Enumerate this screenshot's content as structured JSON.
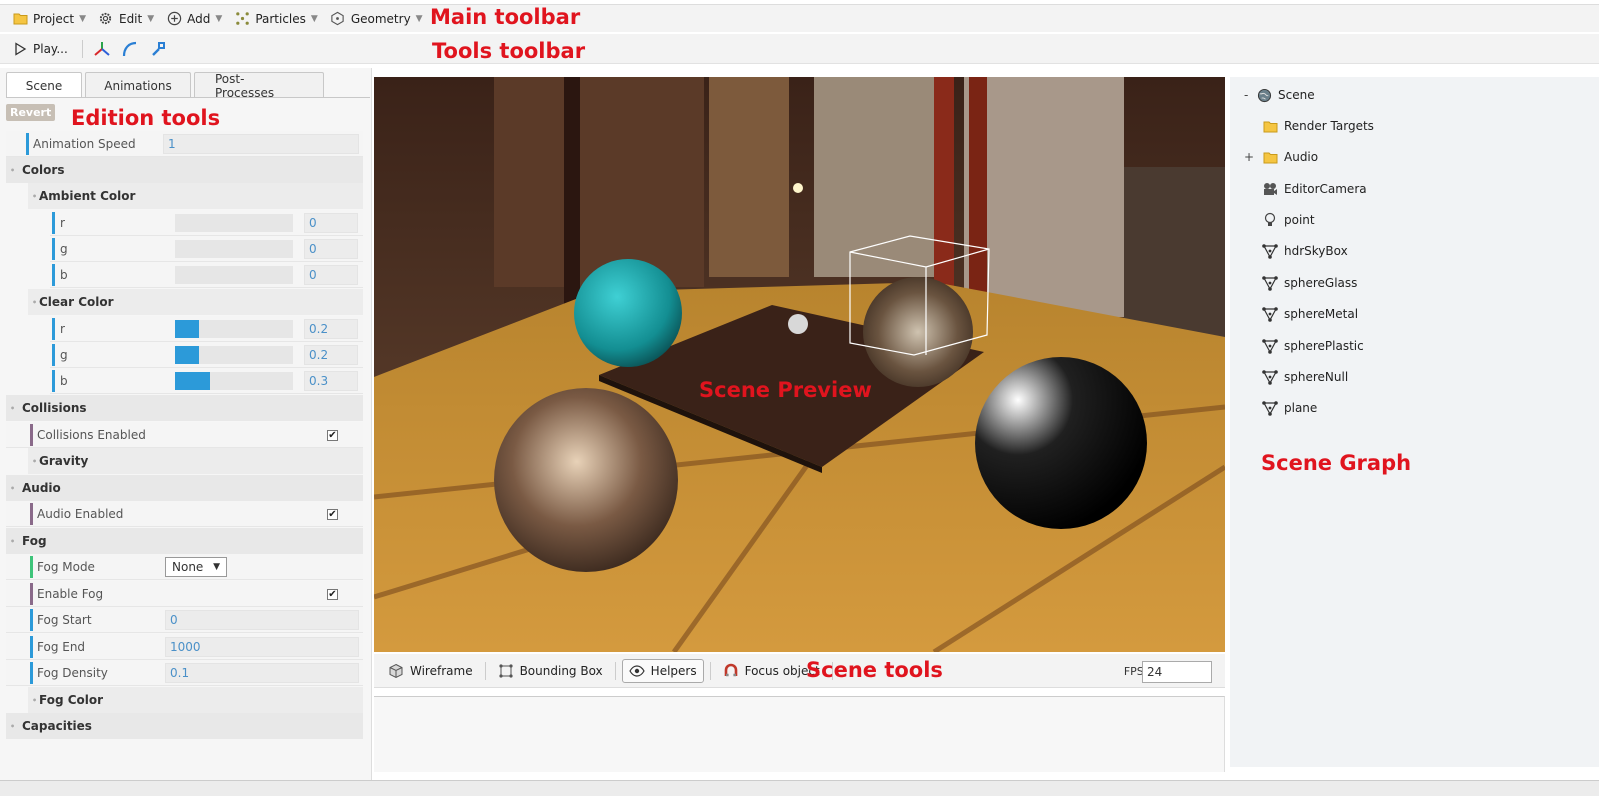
{
  "main_toolbar": {
    "project": "Project",
    "edit": "Edit",
    "add": "Add",
    "particles": "Particles",
    "geometry": "Geometry"
  },
  "tools_toolbar": {
    "play": "Play..."
  },
  "annotations": {
    "main_toolbar": "Main toolbar",
    "tools_toolbar": "Tools toolbar",
    "edition_tools": "Edition tools",
    "scene_preview": "Scene Preview",
    "scene_tools": "Scene tools",
    "scene_graph": "Scene Graph"
  },
  "tabs": [
    "Scene",
    "Animations",
    "Post-Processes"
  ],
  "edition": {
    "revert": "Revert",
    "animation_speed": {
      "label": "Animation Speed",
      "value": "1"
    },
    "colors": "Colors",
    "ambient_color": {
      "title": "Ambient Color",
      "r": {
        "label": "r",
        "value": "0",
        "fraction": 0
      },
      "g": {
        "label": "g",
        "value": "0",
        "fraction": 0
      },
      "b": {
        "label": "b",
        "value": "0",
        "fraction": 0
      }
    },
    "clear_color": {
      "title": "Clear Color",
      "r": {
        "label": "r",
        "value": "0.2",
        "fraction": 0.2
      },
      "g": {
        "label": "g",
        "value": "0.2",
        "fraction": 0.2
      },
      "b": {
        "label": "b",
        "value": "0.3",
        "fraction": 0.3
      }
    },
    "collisions": "Collisions",
    "collisions_enabled": {
      "label": "Collisions Enabled",
      "checked": true
    },
    "gravity": "Gravity",
    "audio": "Audio",
    "audio_enabled": {
      "label": "Audio Enabled",
      "checked": true
    },
    "fog": "Fog",
    "fog_mode": {
      "label": "Fog Mode",
      "value": "None"
    },
    "enable_fog": {
      "label": "Enable Fog",
      "checked": true
    },
    "fog_start": {
      "label": "Fog Start",
      "value": "0"
    },
    "fog_end": {
      "label": "Fog End",
      "value": "1000"
    },
    "fog_density": {
      "label": "Fog Density",
      "value": "0.1"
    },
    "fog_color": "Fog Color",
    "capacities": "Capacities"
  },
  "scene_tools": {
    "wireframe": "Wireframe",
    "bounding_box": "Bounding Box",
    "helpers": "Helpers",
    "focus_object": "Focus object",
    "fps_label": "FPS :",
    "fps_value": "24"
  },
  "scene_graph": {
    "root": {
      "label": "Scene",
      "expander": "-"
    },
    "items": [
      {
        "label": "Render Targets",
        "icon": "folder-icon",
        "expander": ""
      },
      {
        "label": "Audio",
        "icon": "folder-icon",
        "expander": "+"
      },
      {
        "label": "EditorCamera",
        "icon": "camera-icon",
        "expander": ""
      },
      {
        "label": "point",
        "icon": "light-bulb-icon",
        "expander": ""
      },
      {
        "label": "hdrSkyBox",
        "icon": "mesh-icon",
        "expander": ""
      },
      {
        "label": "sphereGlass",
        "icon": "mesh-icon",
        "expander": ""
      },
      {
        "label": "sphereMetal",
        "icon": "mesh-icon",
        "expander": ""
      },
      {
        "label": "spherePlastic",
        "icon": "mesh-icon",
        "expander": ""
      },
      {
        "label": "sphereNull",
        "icon": "mesh-icon",
        "expander": ""
      },
      {
        "label": "plane",
        "icon": "mesh-icon",
        "expander": ""
      }
    ]
  },
  "colors": {
    "annotation": "#e0141e",
    "accent_blue": "#2c9ad9",
    "sphere_cyan": "#1aa3a8"
  }
}
